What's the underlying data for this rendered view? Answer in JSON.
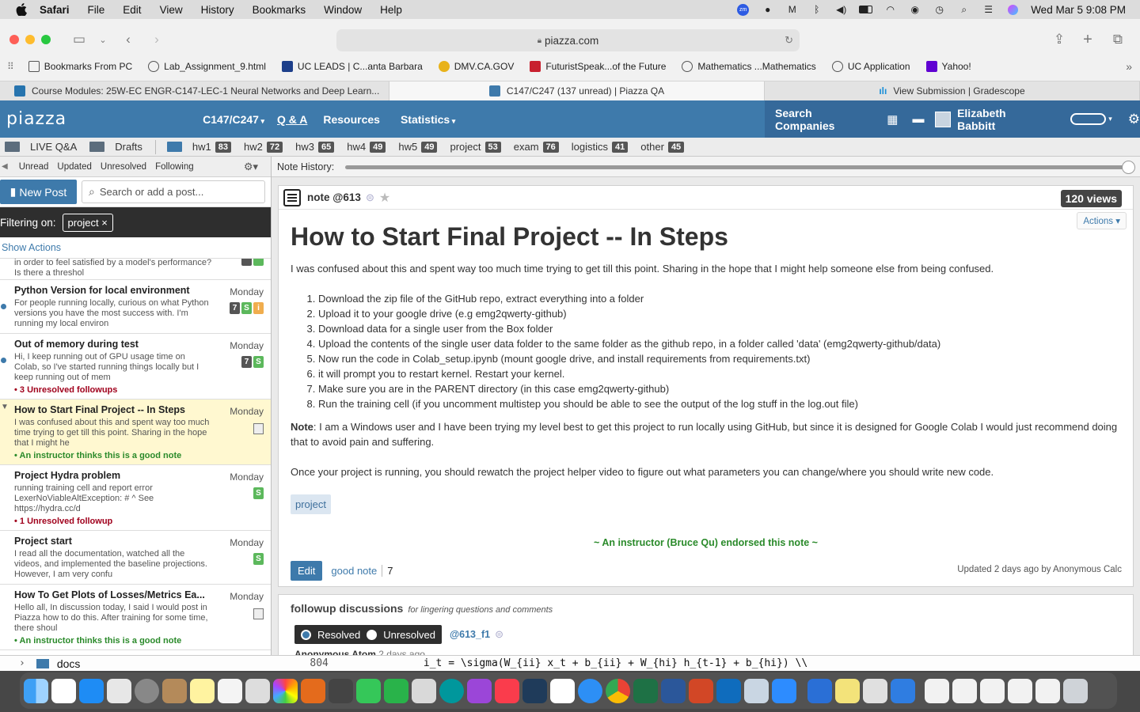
{
  "menubar": {
    "app": "Safari",
    "items": [
      "File",
      "Edit",
      "View",
      "History",
      "Bookmarks",
      "Window",
      "Help"
    ],
    "clock": "Wed Mar 5  9:08 PM"
  },
  "browser": {
    "url": "piazza.com",
    "bookmarks": [
      "Bookmarks From PC",
      "Lab_Assignment_9.html",
      "UC LEADS | C...anta Barbara",
      "DMV.CA.GOV",
      "FuturistSpeak...of the Future",
      "Mathematics ...Mathematics",
      "UC Application",
      "Yahoo!"
    ],
    "tabs": [
      {
        "label": "Course Modules: 25W-EC ENGR-C147-LEC-1 Neural Networks and Deep Learn..."
      },
      {
        "label": "C147/C247 (137 unread) | Piazza QA"
      },
      {
        "label": "View Submission | Gradescope"
      }
    ]
  },
  "piazza": {
    "logo": "piazza",
    "course": "C147/C247",
    "nav": [
      "Q & A",
      "Resources",
      "Statistics"
    ],
    "search_companies": "Search Companies",
    "user": "Elizabeth Babbitt",
    "folders": [
      {
        "label": "LIVE Q&A"
      },
      {
        "label": "Drafts"
      },
      {
        "label": "hw1",
        "count": "83"
      },
      {
        "label": "hw2",
        "count": "72"
      },
      {
        "label": "hw3",
        "count": "65"
      },
      {
        "label": "hw4",
        "count": "49"
      },
      {
        "label": "hw5",
        "count": "49"
      },
      {
        "label": "project",
        "count": "53"
      },
      {
        "label": "exam",
        "count": "76"
      },
      {
        "label": "logistics",
        "count": "41"
      },
      {
        "label": "other",
        "count": "45"
      }
    ],
    "filters": [
      "Unread",
      "Updated",
      "Unresolved",
      "Following"
    ],
    "new_post": "New Post",
    "search_placeholder": "Search or add a post...",
    "filtering_label": "Filtering on:",
    "filter_chip": "project",
    "show_actions": "Show Actions",
    "feed": [
      {
        "title": "",
        "body": "in order to feel satisfied by a model's performance? Is there a threshol",
        "day": "",
        "note": ""
      },
      {
        "title": "Python Version for local environment",
        "body": "For people running locally, curious on what Python versions you have the most success with. I'm running my local environ",
        "day": "Monday",
        "note": ""
      },
      {
        "title": "Out of memory during test",
        "body": "Hi, I keep running out of GPU usage time on Colab, so I've started running things locally but I keep running out of mem",
        "day": "Monday",
        "note": "3 Unresolved followups"
      },
      {
        "title": "How to Start Final Project -- In Steps",
        "body": "I was confused about this and spent way too much time trying to get till this point. Sharing in the hope that I might he",
        "day": "Monday",
        "note": "An instructor thinks this is a good note"
      },
      {
        "title": "Project Hydra problem",
        "body": "running training cell and report error LexerNoViableAltException: # ^ See https://hydra.cc/d",
        "day": "Monday",
        "note": "1 Unresolved followup"
      },
      {
        "title": "Project start",
        "body": "I read all the documentation, watched all the videos, and implemented the baseline projections. However, I am very confu",
        "day": "Monday",
        "note": ""
      },
      {
        "title": "How To Get Plots of Losses/Metrics Ea...",
        "body": "Hello all, In discussion today, I said I would post in Piazza how to do this. After training for some time, there shoul",
        "day": "Monday",
        "note": "An instructor thinks this is a good note"
      }
    ],
    "note_history": "Note History:",
    "note": {
      "id": "note @613",
      "views": "120 views",
      "actions": "Actions",
      "title": "How to Start Final Project -- In Steps",
      "intro": "I was confused about this and spent way too much time trying to get till this point. Sharing in the hope that I might help someone else from being confused.",
      "steps": [
        "Download the zip file of the GitHub repo, extract everything into a folder",
        "Upload it to your google drive (e.g emg2qwerty-github)",
        "Download data for a single user from the Box folder",
        "Upload the contents of the single user data folder to the same folder as the github repo, in a folder called 'data' (emg2qwerty-github/data)",
        "Now run the code in Colab_setup.ipynb (mount google drive, and install requirements from requirements.txt)",
        "it will prompt you to restart kernel. Restart your kernel.",
        "Make sure you are in the PARENT directory (in this case emg2qwerty-github)",
        "Run the training cell (if you uncomment multistep you should be able to see the output of the log stuff in the log.out file)"
      ],
      "note_label": "Note",
      "note_text": ": I am a Windows user and I have been trying my level best to get this project to run locally using GitHub, but since it is designed for Google Colab I would just recommend doing that to avoid pain and suffering.",
      "outro": "Once your project is running, you should rewatch the project helper video to figure out what parameters you can change/where you should write new code.",
      "tag": "project",
      "endorsed": "~ An instructor (Bruce Qu) endorsed this note ~",
      "edit": "Edit",
      "good_note": "good note",
      "good_count": "7",
      "updated": "Updated 2 days ago by Anonymous Calc"
    },
    "followups": {
      "title": "followup discussions",
      "subtitle": "for lingering questions and comments",
      "resolved": "Resolved",
      "unresolved": "Unresolved",
      "id": "@613_f1",
      "author": "Anonymous Atom",
      "time": "2 days ago"
    }
  },
  "terminal": {
    "left": "docs",
    "line_no": "804",
    "code": "i_t = \\sigma(W_{ii} x_t + b_{ii} + W_{hi} h_{t-1} + b_{hi}) \\\\"
  },
  "colors": {
    "piazza_blue": "#3e7aab",
    "good_green": "#2a8a2a",
    "unresolved_red": "#a0001c",
    "selected_bg": "#fff8d0"
  }
}
